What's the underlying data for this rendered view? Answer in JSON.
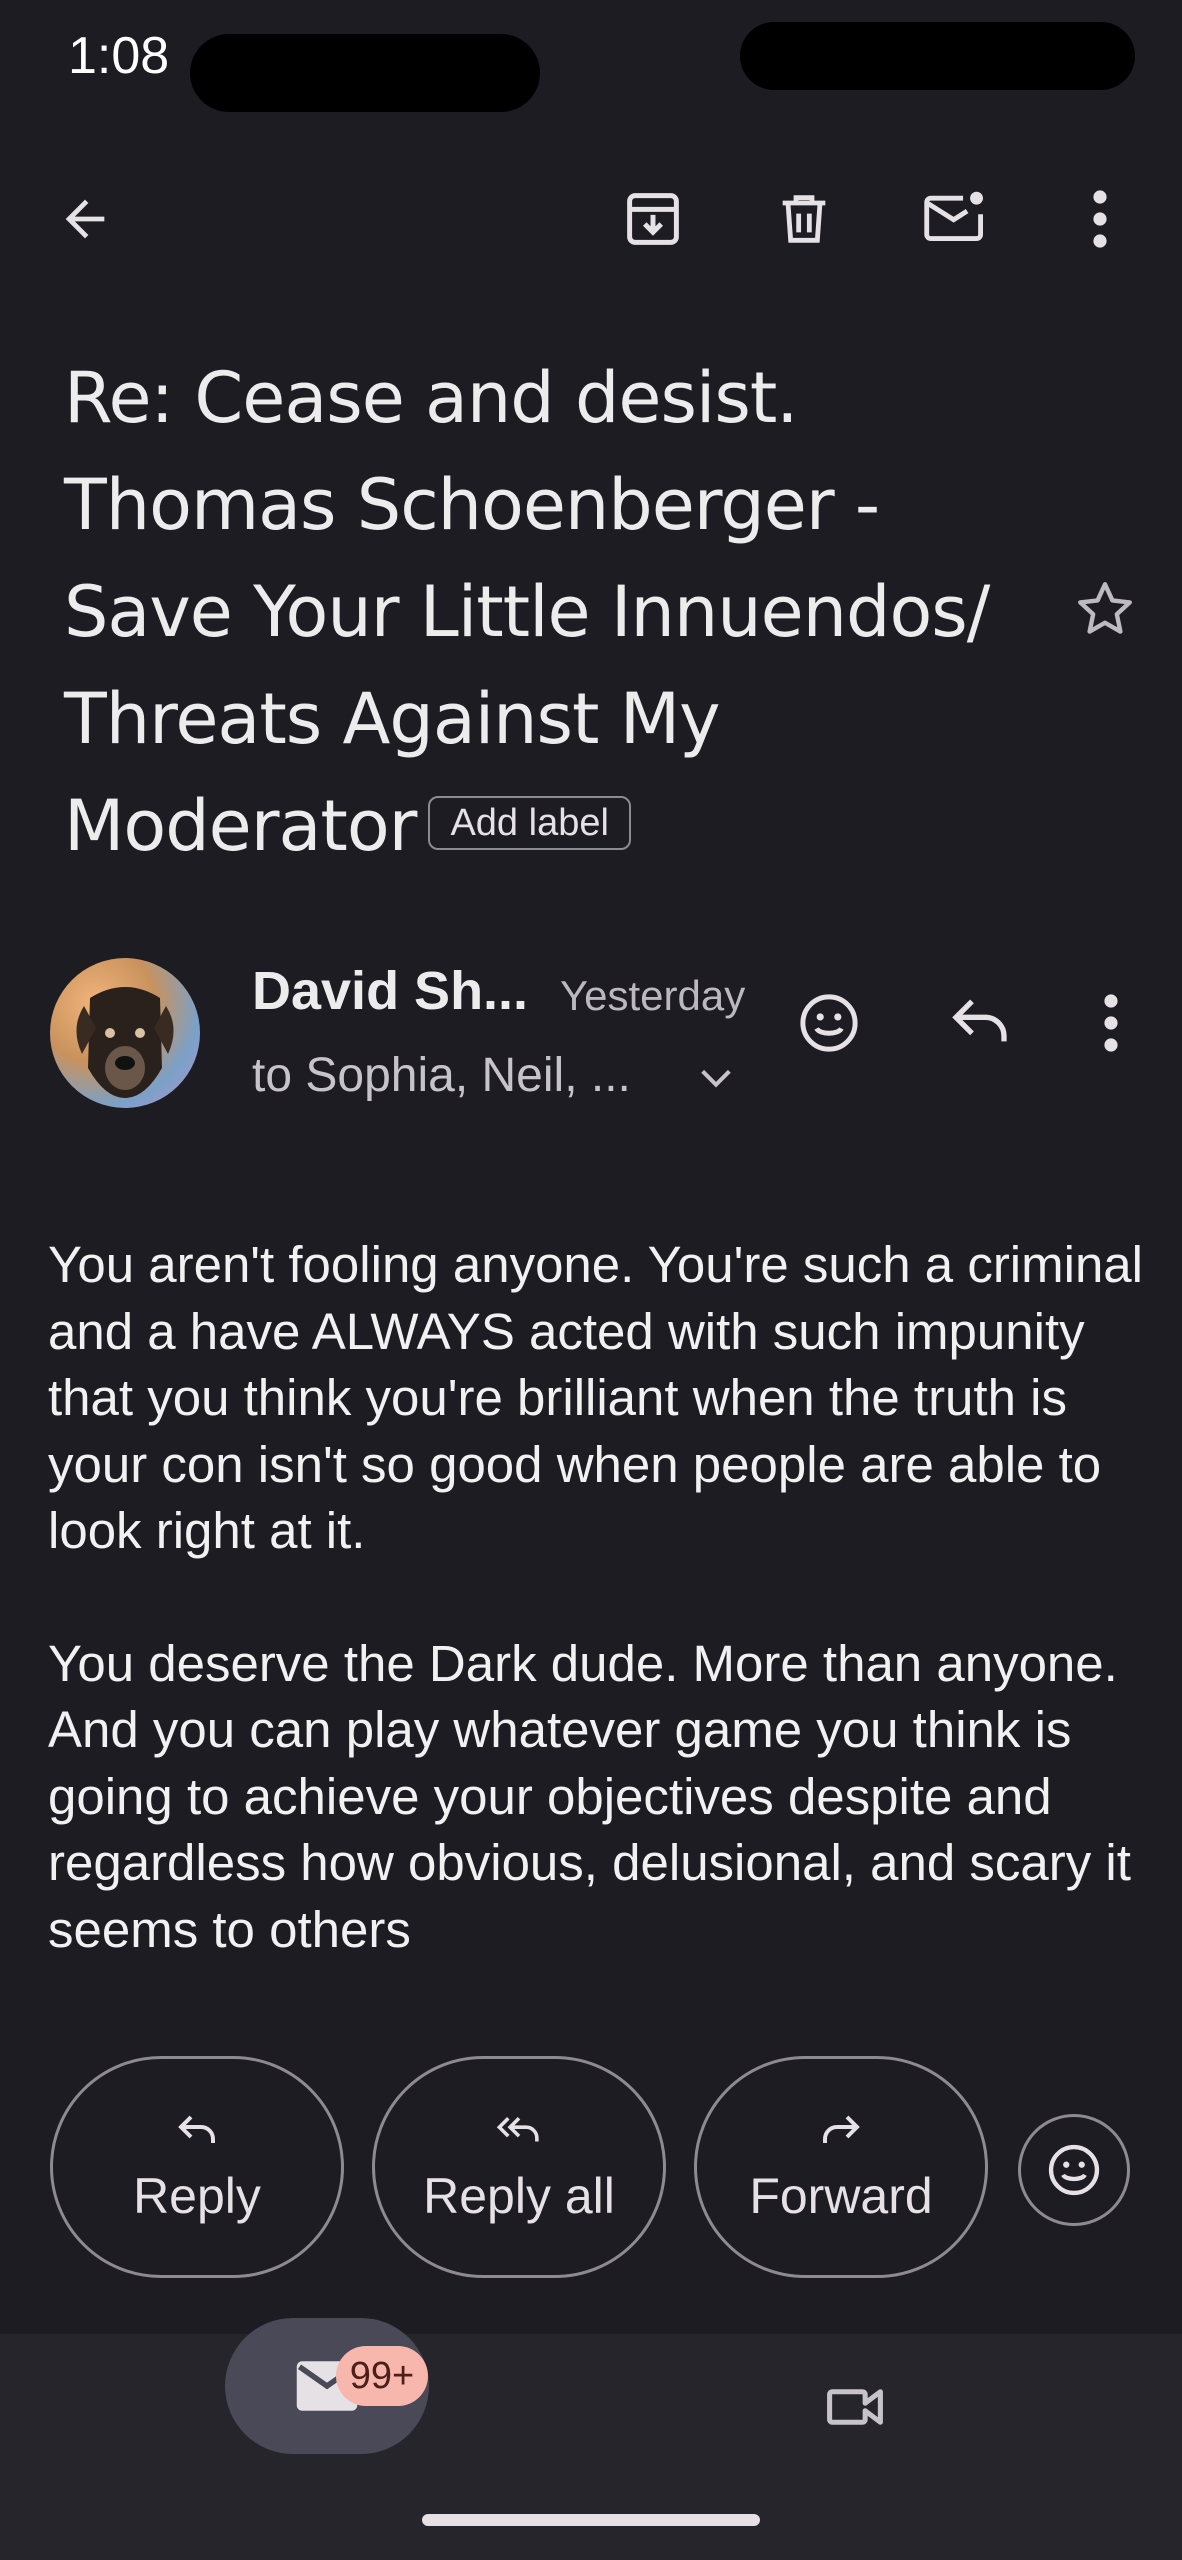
{
  "status_bar": {
    "time": "1:08"
  },
  "subject": {
    "lines": [
      "Re: Cease and desist.",
      "Thomas Schoenberger -",
      "Save Your Little Innuendos/",
      "Threats Against My",
      "Moderator"
    ],
    "add_label": "Add label"
  },
  "message": {
    "sender": "David Sh...",
    "date": "Yesterday",
    "recipients": "to Sophia, Neil, ...",
    "body": [
      "You aren't fooling anyone. You're such a criminal and a have ALWAYS acted with such impunity that you think you're brilliant when the truth is your con isn't so good when people are able to look right at it.",
      "You deserve the Dark dude. More than anyone. And you can play whatever game you think is going to achieve your objectives despite and regardless how obvious, delusional, and scary it seems to others"
    ]
  },
  "actions": {
    "reply": "Reply",
    "reply_all": "Reply all",
    "forward": "Forward"
  },
  "bottom_nav": {
    "mail_badge": "99+"
  },
  "icons": {
    "back": "arrow-back-icon",
    "archive": "archive-icon",
    "delete": "trash-icon",
    "mark_unread": "mark-unread-icon",
    "more": "more-vert-icon",
    "star": "star-outline-icon",
    "emoji": "emoji-reaction-icon",
    "reply": "reply-icon",
    "mail": "mail-icon",
    "meet": "video-icon"
  }
}
